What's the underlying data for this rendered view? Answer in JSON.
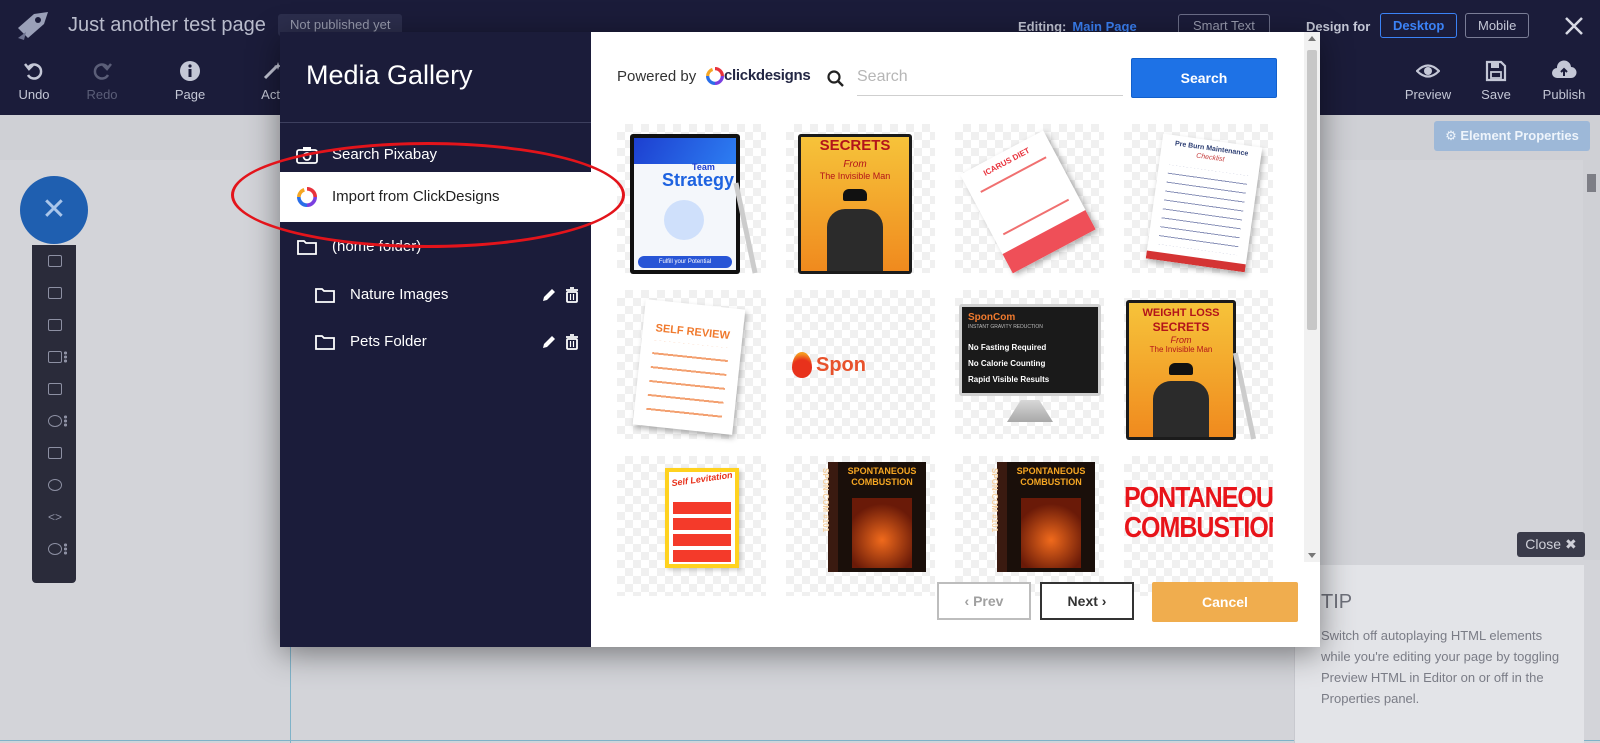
{
  "topbar": {
    "page_title": "Just another test page",
    "publish_status": "Not published yet",
    "editing_label": "Editing:",
    "editing_value": "Main Page",
    "smart_text": "Smart Text",
    "design_for": "Design for",
    "desktop": "Desktop",
    "mobile": "Mobile",
    "tools": {
      "undo": "Undo",
      "redo": "Redo",
      "page": "Page",
      "actions": "Acti",
      "preview": "Preview",
      "save": "Save",
      "publish": "Publish"
    }
  },
  "element_properties": "⚙ Element Properties",
  "tip": {
    "close": "Close ✖",
    "title": "TIP",
    "text": "Switch off autoplaying HTML elements while you're editing your page by toggling Preview HTML in Editor on or off in the Properties panel."
  },
  "modal": {
    "title": "Media Gallery",
    "menu": [
      {
        "label": "Search Pixabay"
      },
      {
        "label": "Import from ClickDesigns"
      },
      {
        "label": "(home folder)"
      },
      {
        "label": "Nature Images"
      },
      {
        "label": "Pets Folder"
      }
    ],
    "powered_by": "Powered by",
    "brand": "clickdesigns",
    "search_placeholder": "Search",
    "search_button": "Search",
    "prev": "‹  Prev",
    "next": "Next  ›",
    "cancel": "Cancel"
  },
  "gallery": [
    {
      "lines": [
        "Team",
        "Strategy",
        "Fulfill your Potential"
      ]
    },
    {
      "lines": [
        "SECRETS",
        "From",
        "The Invisible Man"
      ]
    },
    {
      "lines": [
        "ICARUS DIET"
      ]
    },
    {
      "lines": [
        "Pre Burn Maintenance",
        "Checklist"
      ]
    },
    {
      "lines": [
        "SELF REVIEW"
      ]
    },
    {
      "lines": [
        "Spon"
      ]
    },
    {
      "lines": [
        "SponCom",
        "INSTANT GRAVITY REDUCTION",
        "No Fasting Required",
        "No Calorie Counting",
        "Rapid Visible Results"
      ]
    },
    {
      "lines": [
        "WEIGHT LOSS",
        "SECRETS",
        "From",
        "The Invisible Man"
      ]
    },
    {
      "lines": [
        "Self Levitation"
      ]
    },
    {
      "lines": [
        "SPONTANEOUS",
        "COMBUSTION",
        "SPON-COM #101"
      ]
    },
    {
      "lines": [
        "SPONTANEOUS",
        "COMBUSTION",
        "SPON-COM #101"
      ]
    },
    {
      "lines": [
        "PONTANEOUS",
        "COMBUSTION"
      ]
    }
  ],
  "colors": {
    "topbar": "#1b1c3a",
    "accent_blue": "#1e72e6",
    "cancel_orange": "#f0ad4e",
    "highlight_red": "#e3141b"
  }
}
